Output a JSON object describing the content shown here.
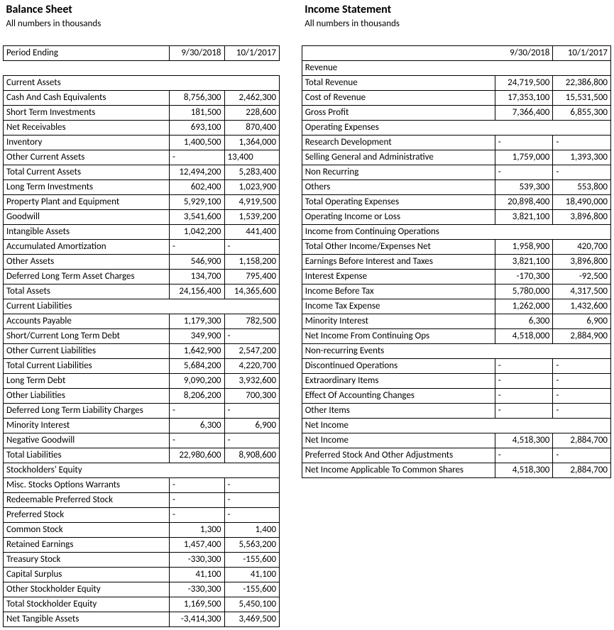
{
  "left": {
    "title": "Balance Sheet",
    "subtitle": "All numbers in thousands",
    "period_label": "Period Ending",
    "dates": [
      "9/30/2018",
      "10/1/2017"
    ],
    "rows": [
      {
        "t": "section",
        "label": "Current Assets"
      },
      {
        "label": "Cash And Cash Equivalents",
        "a": "8,756,300",
        "b": "2,462,300"
      },
      {
        "label": "Short Term Investments",
        "a": "181,500",
        "b": "228,600"
      },
      {
        "label": "Net Receivables",
        "a": "693,100",
        "b": "870,400"
      },
      {
        "label": "Inventory",
        "a": "1,400,500",
        "b": "1,364,000"
      },
      {
        "label": "Other Current Assets",
        "a": "-",
        "b": "13,400",
        "align": "left"
      },
      {
        "label": "Total Current Assets",
        "a": "12,494,200",
        "b": "5,283,400"
      },
      {
        "label": "Long Term Investments",
        "a": "602,400",
        "b": "1,023,900"
      },
      {
        "label": "Property Plant and Equipment",
        "a": "5,929,100",
        "b": "4,919,500"
      },
      {
        "label": "Goodwill",
        "a": "3,541,600",
        "b": "1,539,200"
      },
      {
        "label": "Intangible Assets",
        "a": "1,042,200",
        "b": "441,400"
      },
      {
        "label": "Accumulated Amortization",
        "a": "-",
        "b": "-",
        "align": "left"
      },
      {
        "label": "Other Assets",
        "a": "546,900",
        "b": "1,158,200"
      },
      {
        "label": "Deferred Long Term Asset Charges",
        "a": "134,700",
        "b": "795,400"
      },
      {
        "label": "Total Assets",
        "a": "24,156,400",
        "b": "14,365,600"
      },
      {
        "t": "section",
        "label": "Current Liabilities"
      },
      {
        "label": "Accounts Payable",
        "a": "1,179,300",
        "b": "782,500"
      },
      {
        "label": "Short/Current Long Term Debt",
        "a": "349,900",
        "b": "-",
        "balign": "left"
      },
      {
        "label": "Other Current Liabilities",
        "a": "1,642,900",
        "b": "2,547,200"
      },
      {
        "label": "Total Current Liabilities",
        "a": "5,684,200",
        "b": "4,220,700"
      },
      {
        "label": "Long Term Debt",
        "a": "9,090,200",
        "b": "3,932,600"
      },
      {
        "label": "Other Liabilities",
        "a": "8,206,200",
        "b": "700,300"
      },
      {
        "label": "Deferred Long Term Liability Charges",
        "a": "-",
        "b": "-",
        "align": "left"
      },
      {
        "label": "Minority Interest",
        "a": "6,300",
        "b": "6,900"
      },
      {
        "label": "Negative Goodwill",
        "a": "-",
        "b": "-",
        "align": "left"
      },
      {
        "label": "Total Liabilities",
        "a": "22,980,600",
        "b": "8,908,600"
      },
      {
        "t": "section",
        "label": "Stockholders' Equity"
      },
      {
        "label": "Misc. Stocks Options Warrants",
        "a": "-",
        "b": "-",
        "align": "left"
      },
      {
        "label": "Redeemable Preferred Stock",
        "a": "-",
        "b": "-",
        "align": "left"
      },
      {
        "label": "Preferred Stock",
        "a": "-",
        "b": "-",
        "align": "left"
      },
      {
        "label": "Common Stock",
        "a": "1,300",
        "b": "1,400"
      },
      {
        "label": "Retained Earnings",
        "a": "1,457,400",
        "b": "5,563,200"
      },
      {
        "label": "Treasury Stock",
        "a": "-330,300",
        "b": "-155,600"
      },
      {
        "label": "Capital Surplus",
        "a": "41,100",
        "b": "41,100"
      },
      {
        "label": "Other Stockholder Equity",
        "a": "-330,300",
        "b": "-155,600"
      },
      {
        "label": "Total Stockholder Equity",
        "a": "1,169,500",
        "b": "5,450,100"
      },
      {
        "label": "Net Tangible Assets",
        "a": "-3,414,300",
        "b": "3,469,500"
      }
    ]
  },
  "right": {
    "title": "Income Statement",
    "subtitle": "All numbers in thousands",
    "dates": [
      "9/30/2018",
      "10/1/2017"
    ],
    "rows": [
      {
        "t": "section",
        "label": "Revenue"
      },
      {
        "label": "Total Revenue",
        "a": "24,719,500",
        "b": "22,386,800"
      },
      {
        "label": "Cost of Revenue",
        "a": "17,353,100",
        "b": "15,531,500"
      },
      {
        "label": "Gross Profit",
        "a": "7,366,400",
        "b": "6,855,300"
      },
      {
        "t": "section",
        "label": "Operating Expenses"
      },
      {
        "label": "Research Development",
        "a": "-",
        "b": "-",
        "align": "left"
      },
      {
        "label": "Selling General and Administrative",
        "a": "1,759,000",
        "b": "1,393,300"
      },
      {
        "label": "Non Recurring",
        "a": "-",
        "b": "-",
        "align": "left"
      },
      {
        "label": "Others",
        "a": "539,300",
        "b": "553,800"
      },
      {
        "label": "Total Operating Expenses",
        "a": "20,898,400",
        "b": "18,490,000"
      },
      {
        "label": "Operating Income or Loss",
        "a": "3,821,100",
        "b": "3,896,800"
      },
      {
        "t": "section",
        "label": "Income from Continuing Operations"
      },
      {
        "label": "Total Other Income/Expenses Net",
        "a": "1,958,900",
        "b": "420,700"
      },
      {
        "label": "Earnings Before Interest and Taxes",
        "a": "3,821,100",
        "b": "3,896,800"
      },
      {
        "label": "Interest Expense",
        "a": "-170,300",
        "b": "-92,500"
      },
      {
        "label": "Income Before Tax",
        "a": "5,780,000",
        "b": "4,317,500"
      },
      {
        "label": "Income Tax Expense",
        "a": "1,262,000",
        "b": "1,432,600"
      },
      {
        "label": "Minority Interest",
        "a": "6,300",
        "b": "6,900"
      },
      {
        "label": "Net Income From Continuing Ops",
        "a": "4,518,000",
        "b": "2,884,900"
      },
      {
        "t": "section",
        "label": "Non-recurring Events"
      },
      {
        "label": "Discontinued Operations",
        "a": "-",
        "b": "-",
        "align": "left"
      },
      {
        "label": "Extraordinary Items",
        "a": "-",
        "b": "-",
        "align": "left"
      },
      {
        "label": "Effect Of Accounting Changes",
        "a": "-",
        "b": "-",
        "align": "left"
      },
      {
        "label": "Other Items",
        "a": "-",
        "b": "-",
        "align": "left"
      },
      {
        "t": "section",
        "label": "Net Income"
      },
      {
        "label": "Net Income",
        "a": "4,518,300",
        "b": "2,884,700"
      },
      {
        "label": "Preferred Stock And Other Adjustments",
        "a": "-",
        "b": "-",
        "align": "left"
      },
      {
        "label": "Net Income Applicable To Common Shares",
        "a": "4,518,300",
        "b": "2,884,700"
      }
    ]
  }
}
